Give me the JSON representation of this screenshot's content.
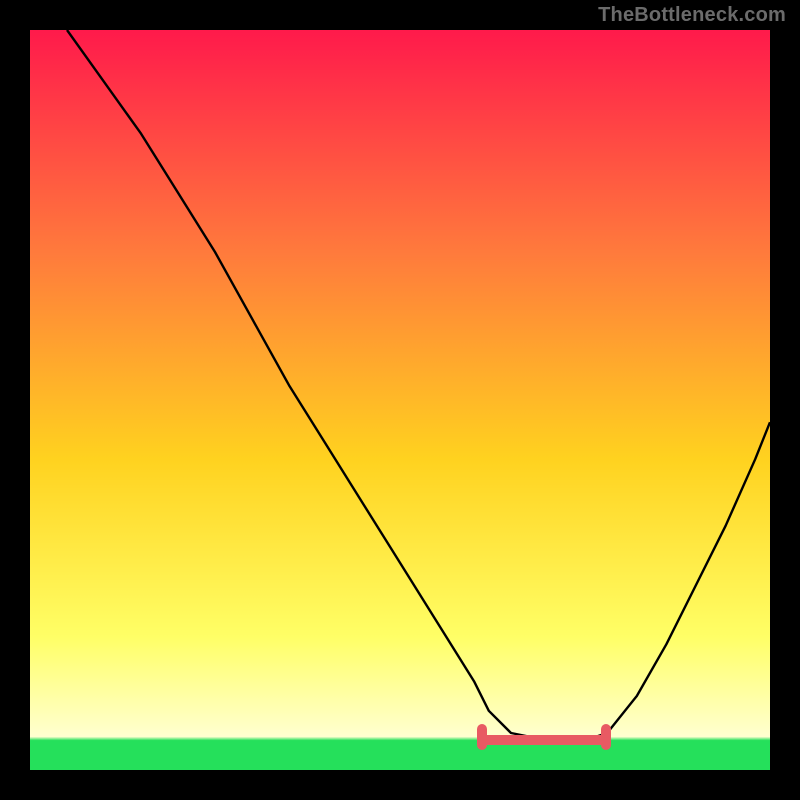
{
  "attribution": "TheBottleneck.com",
  "colors": {
    "gradient_top": "#ff1a4b",
    "gradient_mid_upper": "#ff7a3c",
    "gradient_mid": "#ffd21f",
    "gradient_lower": "#ffff66",
    "gradient_pale": "#ffffd0",
    "bottom_band": "#25e05b",
    "accent": "#e85a63",
    "frame": "#000000",
    "curve": "#000000"
  },
  "chart_data": {
    "type": "line",
    "title": "",
    "xlabel": "",
    "ylabel": "",
    "xlim": [
      0,
      100
    ],
    "ylim": [
      0,
      100
    ],
    "grid": false,
    "legend": false,
    "annotations": [],
    "accent_range_x": [
      61,
      78
    ],
    "series": [
      {
        "name": "curve",
        "x": [
          5,
          10,
          15,
          20,
          25,
          30,
          35,
          40,
          45,
          50,
          55,
          60,
          62,
          65,
          70,
          75,
          78,
          82,
          86,
          90,
          94,
          98,
          100
        ],
        "y": [
          100,
          93,
          86,
          78,
          70,
          61,
          52,
          44,
          36,
          28,
          20,
          12,
          8,
          5,
          4,
          4,
          5,
          10,
          17,
          25,
          33,
          42,
          47
        ]
      }
    ]
  }
}
